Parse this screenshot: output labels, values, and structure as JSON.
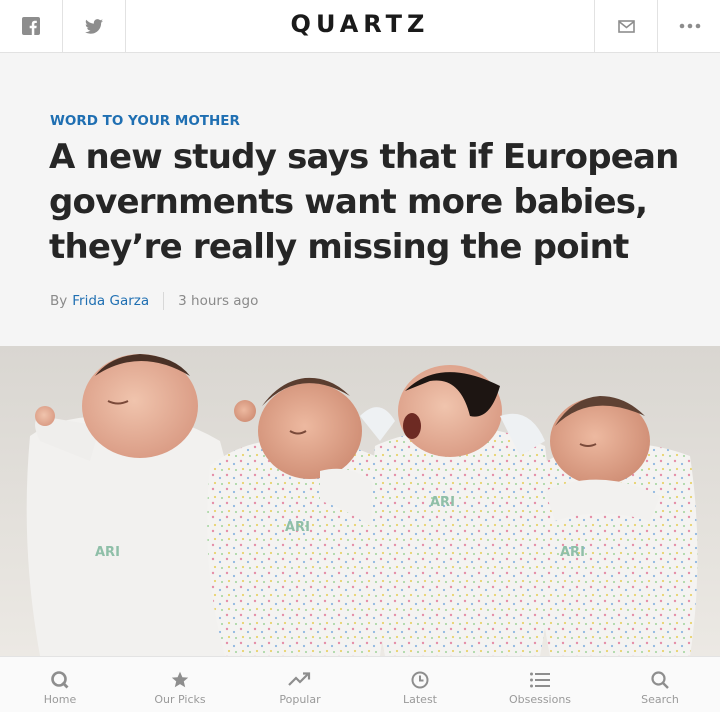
{
  "topbar": {
    "brand": "QUARTZ",
    "left_icons": [
      "facebook-icon",
      "twitter-icon"
    ],
    "right_icons": [
      "mail-icon",
      "more-icon"
    ]
  },
  "article": {
    "kicker": "WORD TO YOUR MOTHER",
    "headline": "A new study says that if European governments want more babies, they’re really missing the point",
    "byline_prefix": "By",
    "author": "Frida Garza",
    "timestamp": "3 hours ago"
  },
  "photo": {
    "onesie_prints": [
      "ARI",
      "ARI",
      "ARI",
      "ARI"
    ]
  },
  "bottom_nav": {
    "items": [
      {
        "label": "Home",
        "icon": "quartz-q-icon"
      },
      {
        "label": "Our Picks",
        "icon": "star-icon"
      },
      {
        "label": "Popular",
        "icon": "trending-icon"
      },
      {
        "label": "Latest",
        "icon": "clock-icon"
      },
      {
        "label": "Obsessions",
        "icon": "list-icon"
      },
      {
        "label": "Search",
        "icon": "search-icon"
      }
    ]
  },
  "colors": {
    "accent": "#1f6fb2",
    "header_bg": "#f5f5f5",
    "headline": "#262626"
  }
}
